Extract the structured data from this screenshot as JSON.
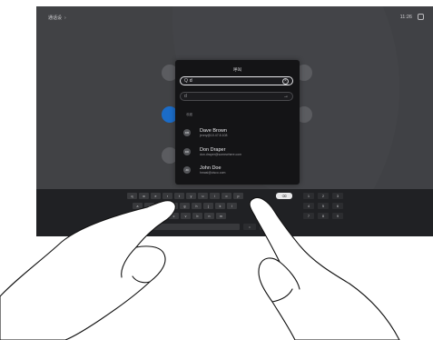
{
  "status": {
    "left_label": "通话设",
    "clock": "11:26"
  },
  "dialog": {
    "title": "呼叫",
    "search": {
      "value": "d",
      "glyph": "Q"
    },
    "address": {
      "placeholder": "d"
    },
    "section_label": "收藏",
    "contacts": [
      {
        "initials": "DB",
        "name": "Dave Brown",
        "detail": "jenny@10.47.8.108"
      },
      {
        "initials": "DD",
        "name": "Don Draper",
        "detail": "don.draper@somewhere.com"
      },
      {
        "initials": "JD",
        "name": "John Doe",
        "detail": "hmasi@cisco.com"
      }
    ]
  },
  "keyboard": {
    "row1": [
      "q",
      "w",
      "e",
      "r",
      "t",
      "y",
      "u",
      "i",
      "o",
      "p"
    ],
    "row2": [
      "a",
      "s",
      "d",
      "f",
      "g",
      "h",
      "j",
      "k",
      "l"
    ],
    "row3": [
      "z",
      "x",
      "c",
      "v",
      "b",
      "n",
      "m"
    ],
    "numpad": [
      "1",
      "2",
      "3",
      "4",
      "5",
      "6",
      "7",
      "8",
      "9"
    ]
  },
  "colors": {
    "screen": "#3a3b3e",
    "dialog": "#141416",
    "accent": "#1b6cc8"
  }
}
